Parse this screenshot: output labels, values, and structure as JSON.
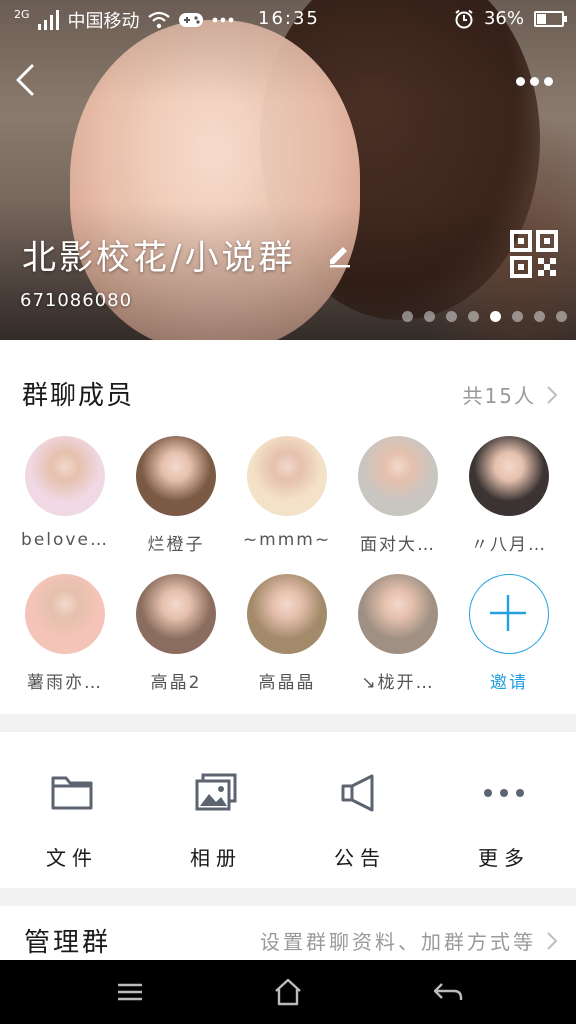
{
  "status_bar": {
    "network": "2G",
    "carrier": "中国移动",
    "time": "16:35",
    "battery": "36%",
    "battery_level": 0.36,
    "icons": [
      "signal-icon",
      "wifi-icon",
      "gamepad-icon",
      "alarm-icon",
      "battery-icon"
    ]
  },
  "header": {
    "group_name": "北影校花/小说群",
    "group_id": "671086080",
    "pager_total": 8,
    "pager_active": 5
  },
  "members": {
    "title": "群聊成员",
    "count_label": "共15人",
    "items": [
      {
        "name": "belove…",
        "color": "#f0d8e4"
      },
      {
        "name": "烂橙子",
        "color": "#7a5a44"
      },
      {
        "name": "~mmm~",
        "color": "#f4e2c8"
      },
      {
        "name": "面对大…",
        "color": "#c9c5c0"
      },
      {
        "name": "〃八月…",
        "color": "#3b3433"
      },
      {
        "name": "薯雨亦…",
        "color": "#f5c4b8"
      },
      {
        "name": "高晶2",
        "color": "#8a6d5e"
      },
      {
        "name": "高晶晶",
        "color": "#a38a6a"
      },
      {
        "name": "↘栊开…",
        "color": "#9f9083"
      }
    ],
    "invite_label": "邀请"
  },
  "actions": [
    {
      "label": "文件",
      "icon": "folder-icon"
    },
    {
      "label": "相册",
      "icon": "album-icon"
    },
    {
      "label": "公告",
      "icon": "megaphone-icon"
    },
    {
      "label": "更多",
      "icon": "more-icon"
    }
  ],
  "manage": {
    "title": "管理群",
    "description": "设置群聊资料、加群方式等"
  },
  "colors": {
    "accent": "#22a0e0",
    "text_secondary": "#9a9a9a",
    "background": "#f2f2f2"
  }
}
